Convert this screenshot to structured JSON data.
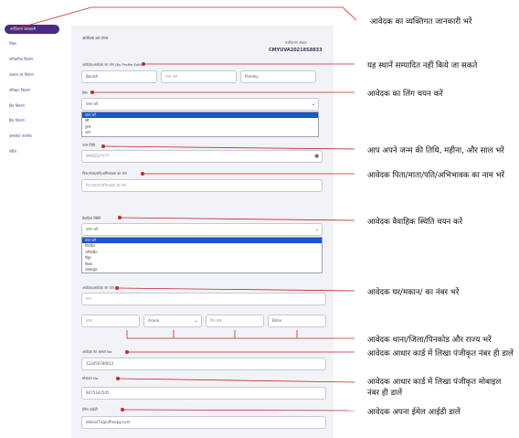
{
  "sidebar": {
    "items": [
      "व्यक्तिगत जानकारी",
      "शिक्षा",
      "पारिवारिक विवरण",
      "आवास का विवरण",
      "परिवहन विवरण",
      "हित विवरण",
      "बैंक विवरण",
      "दस्तावेज़ अपलोड",
      "सेटिंग"
    ]
  },
  "form": {
    "title": "आवेदक का प्रपत्र",
    "reg_label": "पंजीकरण संख्या",
    "reg_number": "CMYUVA20218S8833",
    "name_label": "आवेदक/आवेदक का नाम (By Profile Edit)",
    "first_name": "Bouish",
    "middle_name": "मध्य नाम",
    "last_name": "Pandey",
    "gender_label": "लिंग",
    "gender_value": "चयन करें",
    "gender_options": [
      "चयन करें",
      "स्त्री",
      "पुरुष",
      "अन्य"
    ],
    "dob_label": "जन्म तिथि",
    "dob_placeholder": "MM/DD/YYYY",
    "guardian_label": "पिता/माता/पति/अभिभावक का नाम",
    "guardian_placeholder": "पिता/माता/अभिभावक का नाम",
    "marital_label": "वैवाहिक स्थिति",
    "marital_value": "चयन करें",
    "marital_options": [
      "चयन करें",
      "विवाहित",
      "अविवाहित",
      "विधुर",
      "विधवा",
      "तलाकशुदा"
    ],
    "address_label": "आवेदक/आवेदक का पता",
    "house_placeholder": "पता",
    "thana_placeholder": "थाना",
    "district_value": "Araria",
    "pincode_placeholder": "पिन कोड",
    "state_value": "Bihar",
    "aadhaar_label": "आवेदक का आधार No",
    "aadhaar_value": "123456789012",
    "mobile_label": "मोबाइल No",
    "mobile_value": "9075342545",
    "email_label": "ईमेल आईडी",
    "email_value": "debsol73@offinepg.com"
  },
  "annotations": {
    "a1": "आवेदक का व्यक्तिगत जानकारी भरें",
    "a2": "यह स्थानें सम्पादित नहीं किये जा सकते",
    "a3": "आवेदक का लिंग चयन करें",
    "a4": "आप अपने जन्म की तिथि, महीना, और साल भरें",
    "a5": "आवेदक पिता/माता/पति/अभिभावक का नाम भरें",
    "a6": "आवेदक वैवाहिक स्थिति चयन करें",
    "a7": "आवेदक घर/मकान/ का नंबर भरें",
    "a8": "आवेदक थाना/जिला/पिनकोड और राज्य भरें",
    "a9": "आवेदक आधार कार्ड में लिखा पंजीकृत नंबर ही डालें",
    "a10_line1": "आवेदक आधार कार्ड में लिखा पंजीकृत मोबाइल",
    "a10_line2": "नंबर ही डालें",
    "a11": "आवेदक अपना ईमेल आईडी डालें"
  },
  "colors": {
    "sidebar_active": "#4b2a86",
    "annotation_line": "#c62828",
    "select_highlight": "#1a57c8"
  }
}
